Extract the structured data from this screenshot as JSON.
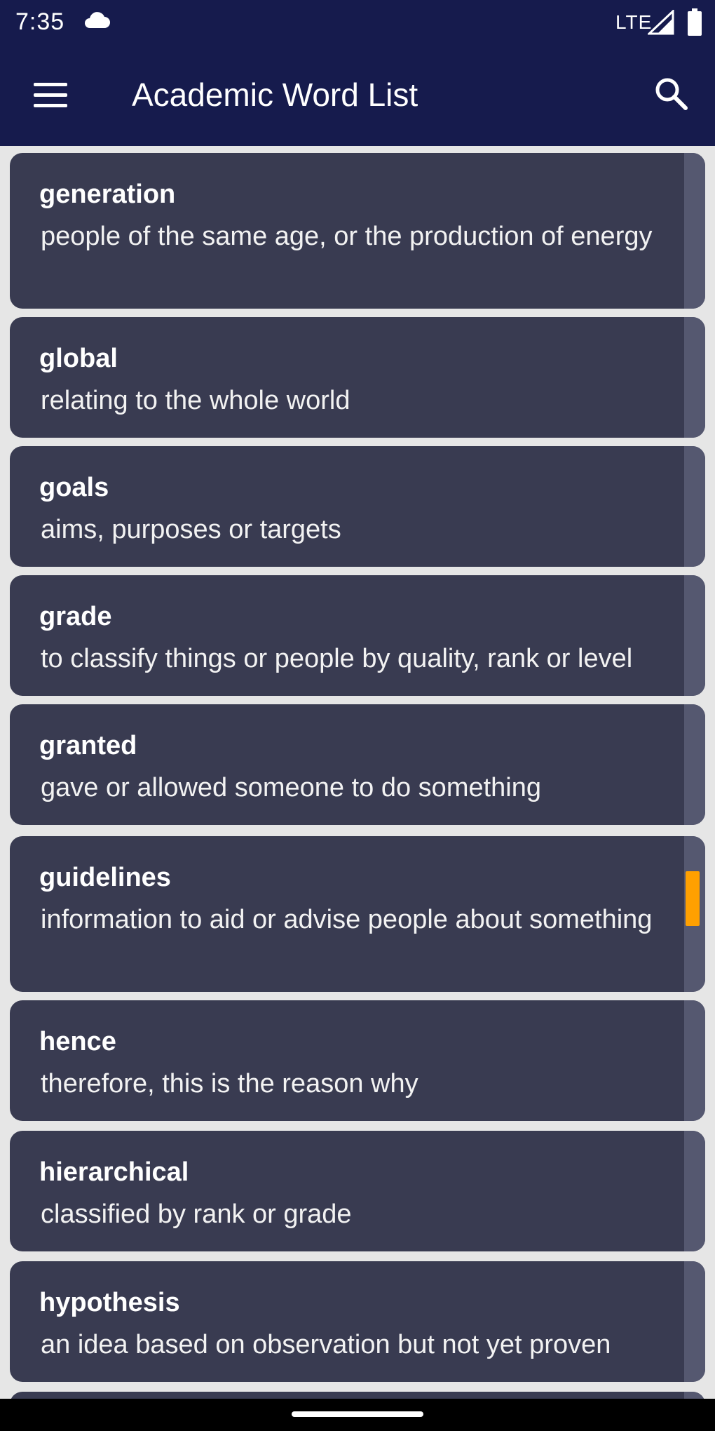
{
  "status_bar": {
    "time": "7:35",
    "cloud_icon": "cloud-icon",
    "network": "LTE",
    "signal_icon": "signal-icon",
    "battery_icon": "battery-icon"
  },
  "app_bar": {
    "title": "Academic Word List",
    "menu_icon": "hamburger-menu-icon",
    "search_icon": "search-icon",
    "background": "#161b4d"
  },
  "words": [
    {
      "word": "generation",
      "definition": "people of the same age, or the production of energy"
    },
    {
      "word": "global",
      "definition": "relating to the whole world"
    },
    {
      "word": "goals",
      "definition": "aims, purposes or targets"
    },
    {
      "word": "grade",
      "definition": "to classify things or people by quality, rank or level"
    },
    {
      "word": "granted",
      "definition": "gave or allowed someone to do something"
    },
    {
      "word": "guidelines",
      "definition": "information to aid or advise people about something"
    },
    {
      "word": "hence",
      "definition": "therefore, this is the reason why"
    },
    {
      "word": "hierarchical",
      "definition": "classified by rank or grade"
    },
    {
      "word": "hypothesis",
      "definition": "an idea based on observation but not yet proven"
    }
  ],
  "colors": {
    "card_background": "#393b51",
    "list_background": "#e6e6e6",
    "scroll_thumb": "#ffa000"
  }
}
